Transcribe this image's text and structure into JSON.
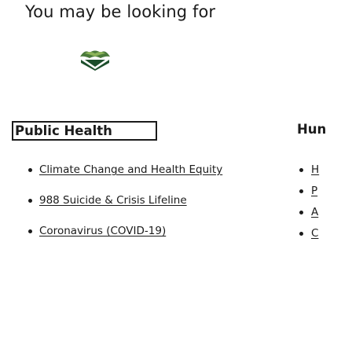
{
  "header": {
    "title": "You may be looking for"
  },
  "logo": {
    "icon": "chevron-down-logo-icon",
    "colors": {
      "dark": "#1c4e2b",
      "mid": "#4a7a3a",
      "light": "#8cb45a"
    }
  },
  "left_column": {
    "category": "Public Health",
    "links": [
      "Climate Change and Health Equity",
      "988 Suicide & Crisis Lifeline",
      "Coronavirus (COVID-19)"
    ]
  },
  "right_column": {
    "category": "Hun",
    "links": [
      "H",
      "P",
      "A",
      "C"
    ]
  }
}
